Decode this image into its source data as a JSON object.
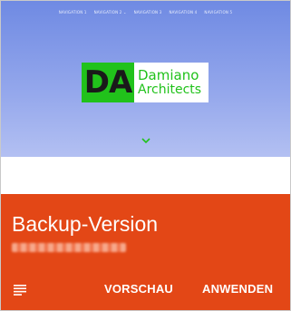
{
  "nav": {
    "items": [
      "NAVIGATION 1",
      "NAVIGATION 2",
      "NAVIGATION 3",
      "NAVIGATION 4",
      "NAVIGATION 5"
    ],
    "dropdown_marker": "⌄"
  },
  "logo": {
    "mark": "DA",
    "line1": "Damiano",
    "line2": "Architects",
    "colors": {
      "mark_bg": "#21c21b",
      "text": "#21c21b"
    }
  },
  "hero": {
    "scroll_icon": "chevron-down-icon"
  },
  "panel": {
    "title": "Backup-Version",
    "subtitle_redacted": true,
    "menu_icon": "menu-lines-icon",
    "preview_label": "VORSCHAU",
    "apply_label": "ANWENDEN",
    "color": "#e34716"
  }
}
